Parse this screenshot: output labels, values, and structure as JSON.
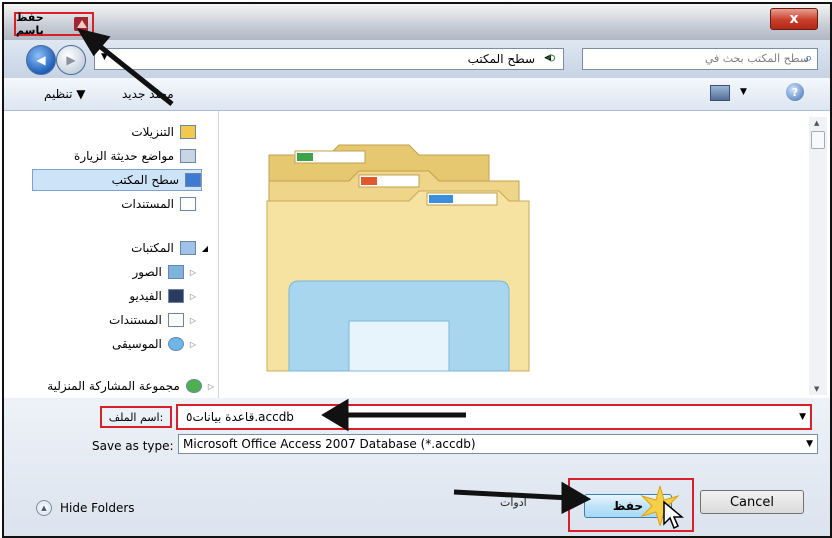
{
  "window": {
    "title": "حفظ باسم",
    "close_label": "x"
  },
  "address_bar": {
    "path": "سطح المكتب",
    "search_placeholder": "سطح المكتب بحث في"
  },
  "toolbar": {
    "organize_label": "تنظيم ▼",
    "new_folder_label": "مجلد جديد"
  },
  "nav": {
    "items": [
      {
        "label": "التنزيلات"
      },
      {
        "label": "مواضع حديثة الزيارة"
      },
      {
        "label": "سطح المكتب"
      },
      {
        "label": "المستندات"
      },
      {
        "label": "المكتبات"
      },
      {
        "label": "الصور"
      },
      {
        "label": "الفيديو"
      },
      {
        "label": "المستندات"
      },
      {
        "label": "الموسيقى"
      },
      {
        "label": "مجموعة المشاركة المنزلية"
      }
    ]
  },
  "form": {
    "filename_label": "اسم الملف:",
    "filename_value": "قاعدة بيانات٥.accdb",
    "savetype_label": "Save as type:",
    "savetype_value": "Microsoft Office Access 2007 Database (*.accdb)"
  },
  "footer": {
    "hide_folders_label": "Hide Folders",
    "tools_label": "أدوات",
    "save_label": "حفظ",
    "cancel_label": "Cancel"
  },
  "colors": {
    "annotation_red": "#d7202a",
    "annotation_arrow": "#111111",
    "folder_yellow": "#f7e3a1"
  }
}
